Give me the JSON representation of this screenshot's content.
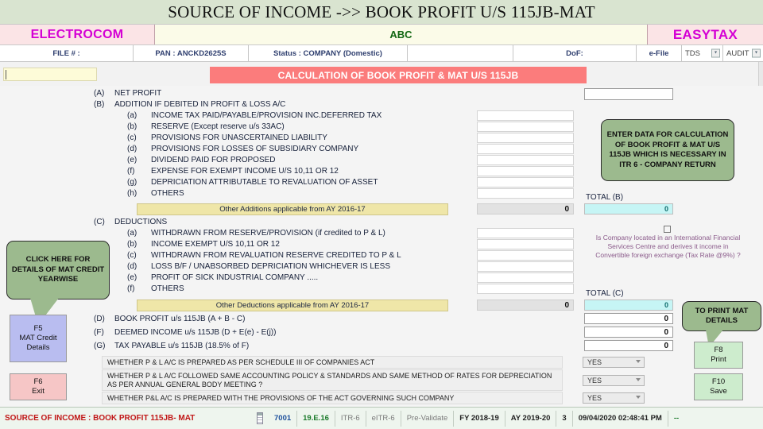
{
  "title_banner": {
    "text": "SOURCE OF INCOME ->> BOOK PROFIT U/S 115JB-MAT"
  },
  "brand": {
    "left": "ELECTROCOM",
    "center": "ABC",
    "right": "EASYTAX"
  },
  "info_row": {
    "file": "FILE # :",
    "pan": "PAN : ANCKD2625S",
    "status": "Status : COMPANY (Domestic)",
    "blank": "",
    "dof": "DoF:",
    "efile": "e-File",
    "tds": "TDS",
    "audit": "AUDIT"
  },
  "red_banner": {
    "text": "CALCULATION OF BOOK PROFIT & MAT U/S 115JB"
  },
  "yellow_field": {
    "value": ""
  },
  "section_a": {
    "letter": "(A)",
    "label": "NET PROFIT",
    "value": ""
  },
  "section_b": {
    "letter": "(B)",
    "label": "ADDITION IF DEBITED IN PROFIT & LOSS A/C",
    "items": [
      {
        "key": "(a)",
        "label": "INCOME TAX PAID/PAYABLE/PROVISION INC.DEFERRED TAX",
        "value": ""
      },
      {
        "key": "(b)",
        "label": "RESERVE (Except reserve u/s 33AC)",
        "value": ""
      },
      {
        "key": "(c)",
        "label": "PROVISIONS FOR UNASCERTAINED LIABILITY",
        "value": ""
      },
      {
        "key": "(d)",
        "label": "PROVISIONS FOR LOSSES OF SUBSIDIARY COMPANY",
        "value": ""
      },
      {
        "key": "(e)",
        "label": "DIVIDEND PAID FOR PROPOSED",
        "value": ""
      },
      {
        "key": "(f)",
        "label": "EXPENSE FOR EXEMPT INCOME U/S 10,11 OR 12",
        "value": ""
      },
      {
        "key": "(g)",
        "label": "DEPRICIATION ATTRIBUTABLE TO REVALUATION OF ASSET",
        "value": ""
      },
      {
        "key": "(h)",
        "label": "OTHERS",
        "value": ""
      }
    ],
    "strip": "Other Additions  applicable from AY 2016-17",
    "strip_value": "0",
    "total_label": "TOTAL (B)",
    "total_value": "0"
  },
  "section_c": {
    "letter": "(C)",
    "label": "DEDUCTIONS",
    "items": [
      {
        "key": "(a)",
        "label": "WITHDRAWN FROM RESERVE/PROVISION (if credited to P & L)",
        "value": ""
      },
      {
        "key": "(b)",
        "label": "INCOME EXEMPT U/S 10,11 OR 12",
        "value": ""
      },
      {
        "key": "(c)",
        "label": "WITHDRAWN FROM REVALUATION RESERVE CREDITED TO P & L",
        "value": ""
      },
      {
        "key": "(d)",
        "label": "LOSS B/F / UNABSORBED DEPRICIATION WHICHEVER IS LESS",
        "value": ""
      },
      {
        "key": "(e)",
        "label": "PROFIT OF SICK INDUSTRIAL COMPANY  .....",
        "value": ""
      },
      {
        "key": "(f)",
        "label": "OTHERS",
        "value": ""
      }
    ],
    "strip": "Other Deductions applicable from AY 2016-17",
    "strip_value": "0",
    "total_label": "TOTAL (C)",
    "total_value": "0"
  },
  "totals_rows": [
    {
      "letter": "(D)",
      "label": "BOOK PROFIT u/s 115JB (A + B - C)",
      "value": "0"
    },
    {
      "letter": "(F)",
      "label": "DEEMED INCOME u/s 115JB (D + E(e) - E(j))",
      "value": "0"
    },
    {
      "letter": "(G)",
      "label": "TAX PAYABLE u/s 115JB (18.5% of F)",
      "value": "0"
    }
  ],
  "questions": [
    {
      "text": "WHETHER P & L A/C IS PREPARED AS PER SCHEDULE III OF COMPANIES ACT",
      "answer": "YES"
    },
    {
      "text": "WHETHER P & L A/C FOLLOWED SAME ACCOUNTING POLICY & STANDARDS AND SAME METHOD OF RATES FOR DEPRECIATION AS PER ANNUAL GENERAL BODY MEETING ?",
      "answer": "YES"
    },
    {
      "text": "WHETHER P&L A/C IS PREPARED WITH THE PROVISIONS OF THE ACT GOVERNING SUCH COMPANY",
      "answer": "YES"
    }
  ],
  "ifsc_checkbox": {
    "checked": false,
    "text": "Is Company located in an International Financial Services Centre and derives it income in Convertible foreign exchange (Tax Rate @9%) ?"
  },
  "callouts": {
    "left": "CLICK HERE FOR DETAILS OF MAT CREDIT YEARWISE",
    "right_green": "ENTER DATA FOR CALCULATION OF BOOK PROFIT & MAT U/S 115JB WHICH IS NECESSARY IN ITR 6 - COMPANY RETURN",
    "print": "TO PRINT MAT DETAILS"
  },
  "buttons": {
    "f5_key": "F5",
    "f5_label": "MAT Credit Details",
    "f6_key": "F6",
    "f6_label": "Exit",
    "f8_key": "F8",
    "f8_label": "Print",
    "f10_key": "F10",
    "f10_label": "Save"
  },
  "status_bar": {
    "title": "SOURCE OF INCOME : BOOK PROFIT 115JB- MAT",
    "code": "7001",
    "version": "19.E.16",
    "itr": "ITR-6",
    "eitr": "eITR-6",
    "prevalidate": "Pre-Validate",
    "fy": "FY 2018-19",
    "ay": "AY 2019-20",
    "count": "3",
    "datetime": "09/04/2020 02:48:41 PM",
    "trailing": "--"
  },
  "colors": {
    "banner_green": "#d9e4d0",
    "brand_pink": "#fbe4e6",
    "magenta": "#d400d4",
    "red_banner": "#fb7c7c",
    "callout_green": "#9cba8e",
    "yellow_strip": "#efe6a8",
    "cyan_total": "#c6f5f5",
    "blue_button": "#b9bdf0",
    "pink_button": "#f6c6c6",
    "green_button": "#cdeccd",
    "status_red": "#c11818"
  }
}
